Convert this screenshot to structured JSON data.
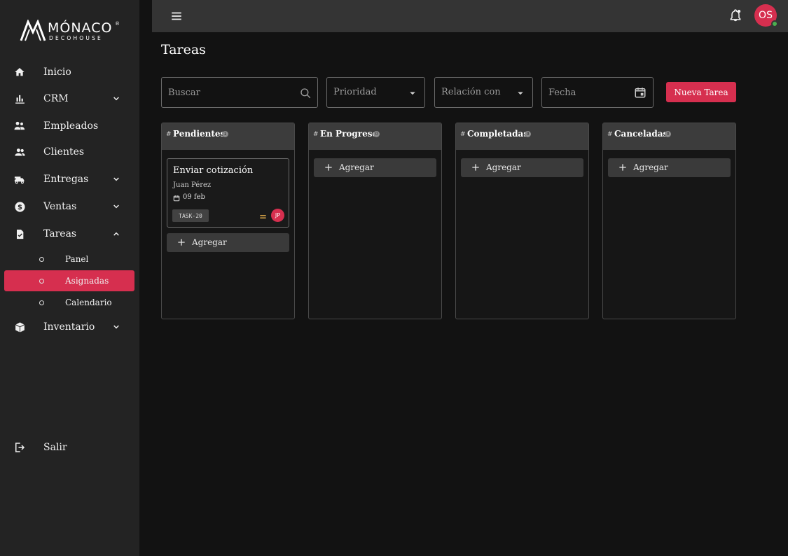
{
  "brand": {
    "name": "MÓNACO",
    "registered": "®",
    "subtitle": "DECOHOUSE"
  },
  "sidebar": {
    "items": [
      {
        "label": "Inicio",
        "icon": "home-icon"
      },
      {
        "label": "CRM",
        "icon": "bar-chart-icon"
      },
      {
        "label": "Empleados",
        "icon": "employees-icon"
      },
      {
        "label": "Clientes",
        "icon": "clients-icon"
      },
      {
        "label": "Entregas",
        "icon": "delivery-truck-icon"
      },
      {
        "label": "Ventas",
        "icon": "dollar-icon"
      },
      {
        "label": "Tareas",
        "icon": "task-icon"
      },
      {
        "label": "Inventario",
        "icon": "box-icon"
      }
    ],
    "tareas_sub": [
      {
        "label": "Panel"
      },
      {
        "label": "Asignadas",
        "active": true
      },
      {
        "label": "Calendario"
      }
    ],
    "logout": {
      "label": "Salir",
      "icon": "logout-icon"
    }
  },
  "topbar": {
    "avatar_initials": "OS"
  },
  "page": {
    "title": "Tareas"
  },
  "filters": {
    "search_placeholder": "Buscar",
    "priority_placeholder": "Prioridad",
    "relation_placeholder": "Relación con",
    "date_placeholder": "Fecha",
    "new_task_label": "Nueva Tarea"
  },
  "columns": [
    {
      "title": "Pendientes",
      "count": "1"
    },
    {
      "title": "En Progreso",
      "count": "0"
    },
    {
      "title": "Completadas",
      "count": "0"
    },
    {
      "title": "Canceladas",
      "count": "0"
    }
  ],
  "add_label": "Agregar",
  "card": {
    "title": "Enviar cotización",
    "person": "Juan Pérez",
    "date": "09 feb",
    "tag": "TASK-20",
    "assignee_initials": "JP"
  },
  "colors": {
    "accent": "#d62f4f",
    "priority_medium": "#e8b04a",
    "online": "#4caf50"
  }
}
